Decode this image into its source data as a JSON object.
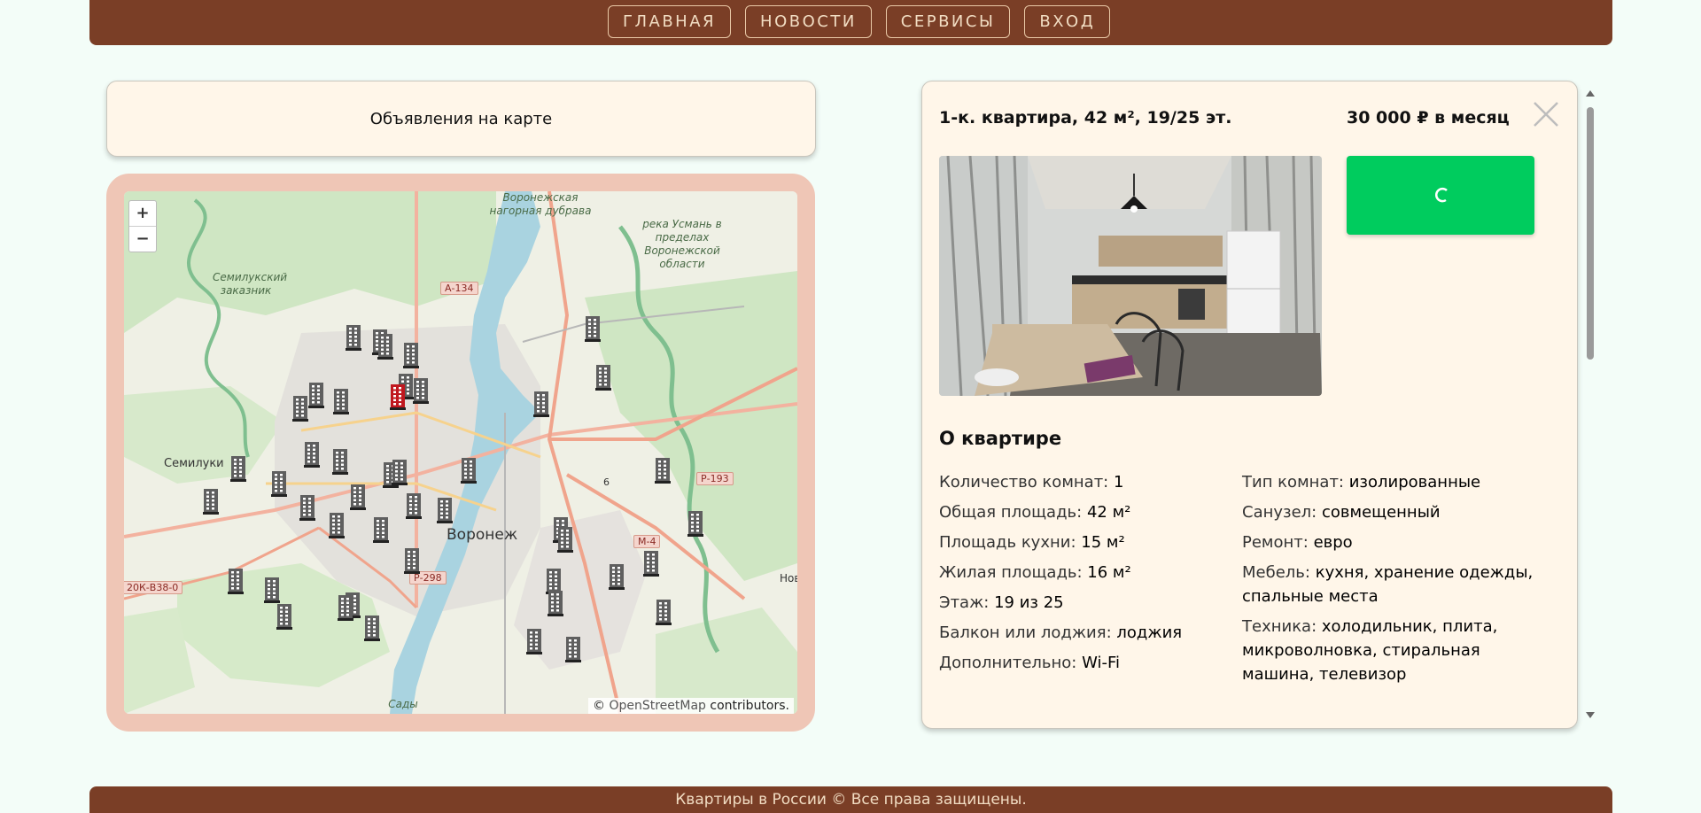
{
  "nav": {
    "items": [
      {
        "label": "ГЛАВНАЯ"
      },
      {
        "label": "НОВОСТИ"
      },
      {
        "label": "СЕРВИСЫ"
      },
      {
        "label": "ВХОД"
      }
    ]
  },
  "listing_header": {
    "title": "Объявления на карте"
  },
  "map": {
    "zoom_in": "+",
    "zoom_out": "−",
    "attribution_prefix": "©",
    "attribution_link": "OpenStreetMap",
    "attribution_suffix": "contributors.",
    "labels": {
      "voronezh_forest": "Воронежская нагорная дубрава",
      "usman_river": "река Усмань в пределах Воронежской области",
      "semiluki_reserve": "Семилукский заказник",
      "semiluki": "Семилуки",
      "voronezh": "Воронеж",
      "sady": "Сады",
      "nov": "Нов"
    },
    "roads": {
      "a134": "А-134",
      "r193": "Р-193",
      "m4": "М-4",
      "r298": "Р-298",
      "k38": "20К-В38-0",
      "six": "6"
    }
  },
  "detail": {
    "title": "1-к. квартира, 42 м², 19/25 эт.",
    "price": "30 000 ₽ в месяц",
    "section_heading": "О квартире",
    "left_props": [
      {
        "key": "Количество комнат:",
        "value": "1"
      },
      {
        "key": "Общая площадь:",
        "value": "42 м²"
      },
      {
        "key": "Площадь кухни:",
        "value": "15 м²"
      },
      {
        "key": "Жилая площадь:",
        "value": "16 м²"
      },
      {
        "key": "Этаж:",
        "value": "19 из 25"
      },
      {
        "key": "Балкон или лоджия:",
        "value": "лоджия"
      },
      {
        "key": "Дополнительно:",
        "value": "Wi-Fi"
      }
    ],
    "right_props": [
      {
        "key": "Тип комнат:",
        "value": "изолированные"
      },
      {
        "key": "Санузел:",
        "value": "совмещенный"
      },
      {
        "key": "Ремонт:",
        "value": "евро"
      },
      {
        "key": "Мебель:",
        "value": "кухня, хранение одежды, спальные места"
      },
      {
        "key": "Техника:",
        "value": "холодильник, плита, микроволновка, стиральная машина, телевизор"
      }
    ]
  },
  "footer": {
    "text": "Квартиры в России © Все права защищены."
  },
  "colors": {
    "header_bg": "#7a3e26",
    "accent_green": "#00cc5e",
    "card_bg": "#fff6e9",
    "selected_pin": "#c0181f",
    "pin": "#5f5f5f"
  }
}
